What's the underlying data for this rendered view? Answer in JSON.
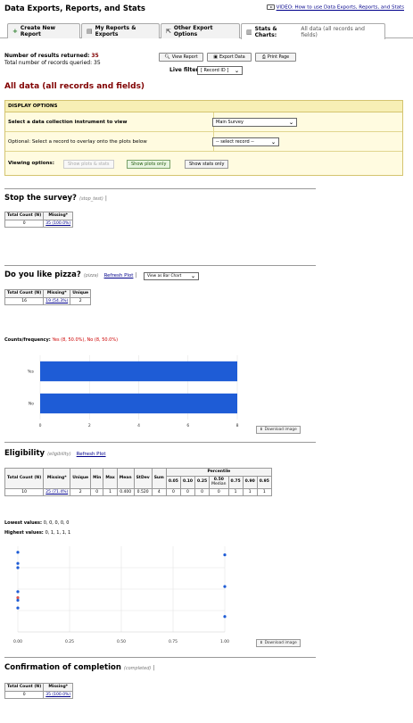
{
  "header": {
    "title": "Data Exports, Reports, and Stats",
    "video_link": "VIDEO: How to use Data Exports, Reports, and Stats"
  },
  "tabs": [
    {
      "label": "Create New Report",
      "icon": "plus-icon"
    },
    {
      "label": "My Reports & Exports",
      "icon": "report-icon"
    },
    {
      "label": "Other Export Options",
      "icon": "export-icon"
    },
    {
      "label": "Stats & Charts:",
      "sub": "All data (all records and fields)",
      "icon": "chart-icon"
    }
  ],
  "summary": {
    "results_label": "Number of results returned:",
    "results_value": "35",
    "queried_label": "Total number of records queried:",
    "queried_value": "35"
  },
  "actions": {
    "view_report": "View Report",
    "export_data": "Export Data",
    "print_page": "Print Page"
  },
  "live_filters": {
    "label": "Live filters:",
    "value": "[ Record ID ]"
  },
  "report_title": "All data (all records and fields)",
  "display_options": {
    "header": "DISPLAY OPTIONS",
    "instrument_label": "Select a data collection instrument to view",
    "instrument_value": "Main Survey",
    "overlay_label": "Optional: Select a record to overlay onto the plots below",
    "overlay_value": "-- select record --",
    "viewing_label": "Viewing options:",
    "btn_both": "Show plots & stats",
    "btn_plots": "Show plots only",
    "btn_stats": "Show stats only"
  },
  "fields": {
    "stop": {
      "title": "Stop the survey?",
      "var": "(stop_test)",
      "headers": [
        "Total Count (N)",
        "Missing*"
      ],
      "row": [
        "0",
        "35 (100.0%)"
      ]
    },
    "pizza": {
      "title": "Do you like pizza?",
      "var": "(pizza)",
      "refresh": "Refresh Plot",
      "view_as": "View as Bar Chart",
      "headers": [
        "Total Count (N)",
        "Missing*",
        "Unique"
      ],
      "row": [
        "16",
        "19 (54.3%)",
        "2"
      ],
      "counts_label": "Counts/frequency:",
      "counts_value": "Yes (8, 50.0%), No (8, 50.0%)",
      "download": "Download image"
    },
    "eligibility": {
      "title": "Eligibility",
      "var": "(eligibility)",
      "refresh": "Refresh Plot",
      "headers": [
        "Total Count (N)",
        "Missing*",
        "Unique",
        "Min",
        "Max",
        "Mean",
        "StDev",
        "Sum"
      ],
      "percentile_header": "Percentile",
      "percentiles": [
        "0.05",
        "0.10",
        "0.25",
        "0.50",
        "0.75",
        "0.90",
        "0.95"
      ],
      "median_label": "Median",
      "row": [
        "10",
        "25 (71.4%)",
        "2",
        "0",
        "1",
        "0.400",
        "0.520",
        "4",
        "0",
        "0",
        "0",
        "0",
        "1",
        "1",
        "1"
      ],
      "lowest_label": "Lowest values:",
      "lowest_value": "0, 0, 0, 0, 0",
      "highest_label": "Highest values:",
      "highest_value": "0, 1, 1, 1, 1",
      "download": "Download image"
    },
    "completed": {
      "title": "Confirmation of completion",
      "var": "(completed)",
      "headers": [
        "Total Count (N)",
        "Missing*"
      ],
      "row": [
        "0",
        "35 (100.0%)"
      ]
    }
  },
  "chart_data": [
    {
      "type": "bar",
      "orientation": "horizontal",
      "categories": [
        "Yes",
        "No"
      ],
      "values": [
        8,
        8
      ],
      "xlim": [
        0,
        8
      ],
      "xticks": [
        0,
        2,
        4,
        6,
        8
      ],
      "grid": true,
      "color": "#1e5cd6"
    },
    {
      "type": "scatter",
      "xlim": [
        0,
        1
      ],
      "xticks": [
        "0.00",
        "0.25",
        "0.50",
        "0.75",
        "1.00"
      ],
      "grid": true,
      "points": [
        {
          "x": 0,
          "y": 0.93,
          "color": "#1e5cd6"
        },
        {
          "x": 0,
          "y": 0.8,
          "color": "#1e5cd6"
        },
        {
          "x": 0,
          "y": 0.75,
          "color": "#1e5cd6"
        },
        {
          "x": 0,
          "y": 0.47,
          "color": "#1e5cd6"
        },
        {
          "x": 0,
          "y": 0.4,
          "color": "#d9534f"
        },
        {
          "x": 0,
          "y": 0.37,
          "color": "#1e5cd6"
        },
        {
          "x": 0,
          "y": 0.28,
          "color": "#1e5cd6"
        },
        {
          "x": 1,
          "y": 0.9,
          "color": "#1e5cd6"
        },
        {
          "x": 1,
          "y": 0.53,
          "color": "#1e5cd6"
        },
        {
          "x": 1,
          "y": 0.18,
          "color": "#1e5cd6"
        }
      ]
    }
  ]
}
